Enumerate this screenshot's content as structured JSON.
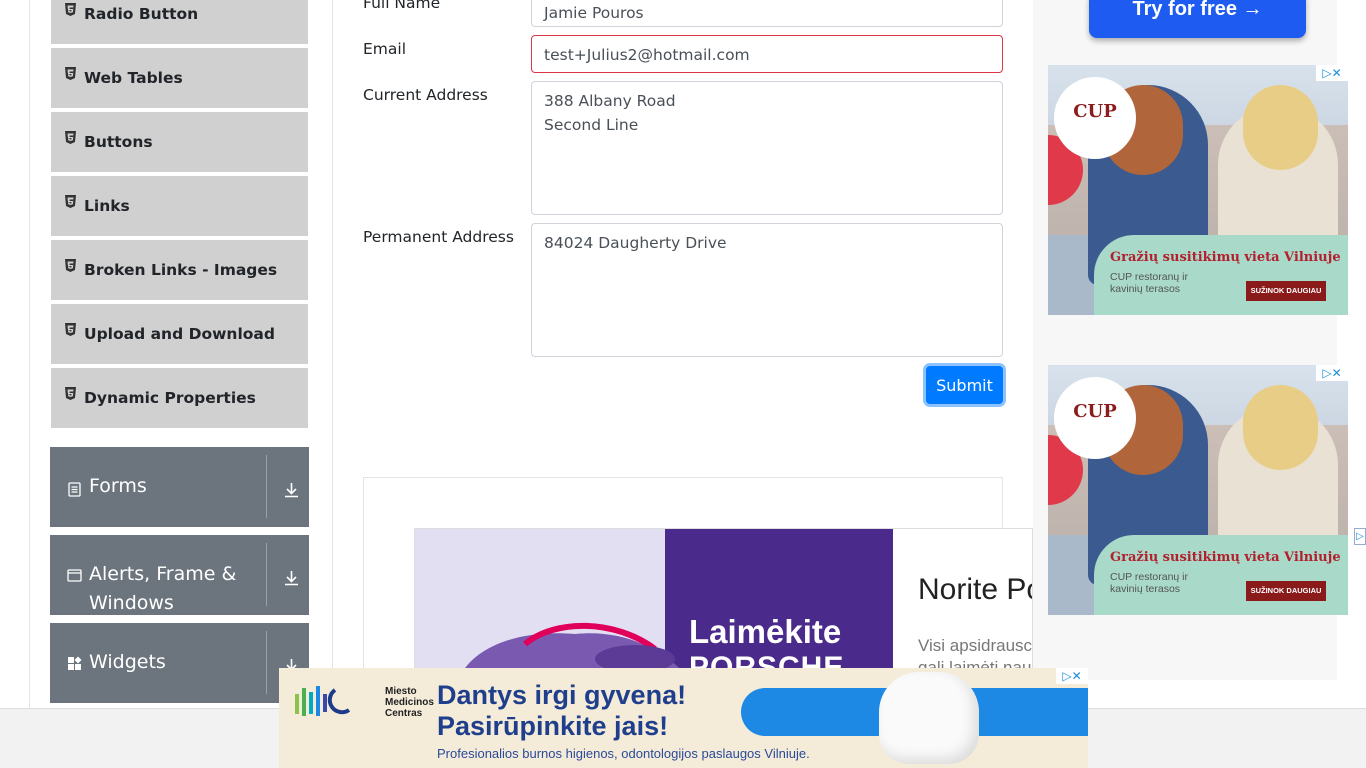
{
  "sidebar": {
    "items": [
      {
        "label": "Radio Button"
      },
      {
        "label": "Web Tables"
      },
      {
        "label": "Buttons"
      },
      {
        "label": "Links"
      },
      {
        "label": "Broken Links - Images"
      },
      {
        "label": "Upload and Download"
      },
      {
        "label": "Dynamic Properties"
      }
    ],
    "groups": [
      {
        "label": "Forms",
        "icon": "form-icon"
      },
      {
        "label": "Alerts, Frame & Windows",
        "icon": "window-icon"
      },
      {
        "label": "Widgets",
        "icon": "widgets-icon"
      }
    ]
  },
  "form": {
    "full_name_label": "Full Name",
    "full_name_value": "Jamie Pouros",
    "email_label": "Email",
    "email_value": "test+Julius2@hotmail.com",
    "current_address_label": "Current Address",
    "current_address_value": "388 Albany Road\nSecond Line",
    "permanent_address_label": "Permanent Address",
    "permanent_address_value": "84024 Daugherty Drive",
    "submit_label": "Submit"
  },
  "ads": {
    "try_free": "Try for free →",
    "cup": {
      "logo": "CUP",
      "headline": "Gražių susitikimų vieta Vilniuje",
      "sub": "CUP restoranų ir kavinių terasos",
      "cta": "SUŽINOK DAUGIAU"
    },
    "porsche": {
      "line1": "Laimėkite",
      "line2": "PORSCHE",
      "heading": "Norite Po",
      "body1": "Visi apsidrausc",
      "body2": "gali laimėti nau"
    },
    "dental": {
      "org": "Miesto\nMedicinos\nCentras",
      "line1": "Dantys irgi gyvena!",
      "line2": "Pasirūpinkite jais!",
      "line3": "Profesionalios burnos higienos, odontologijos paslaugos Vilniuje."
    }
  },
  "colors": {
    "primary": "#007bff",
    "error_border": "#dc3545",
    "group_bg": "#6c757d",
    "item_bg": "#d0d0d0"
  }
}
